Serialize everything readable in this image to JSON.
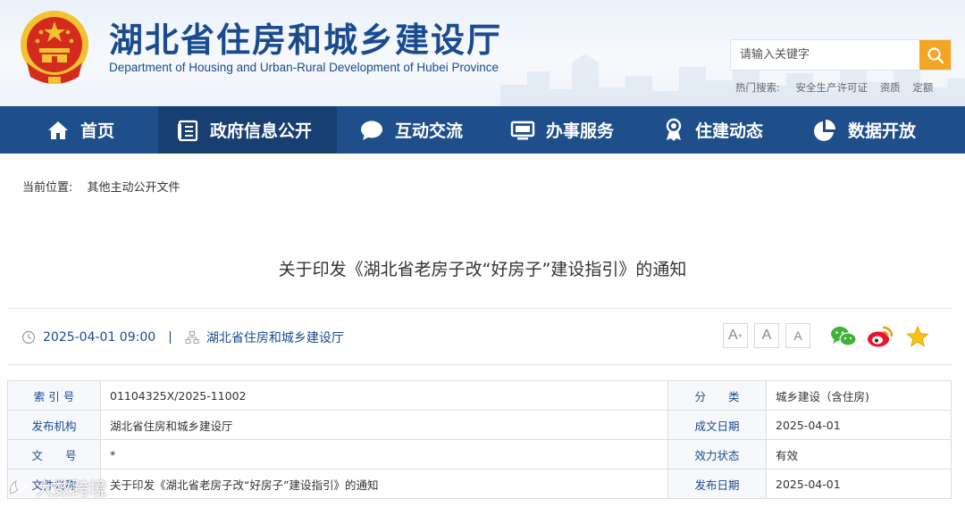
{
  "header": {
    "title": "湖北省住房和城乡建设厅",
    "subtitle": "Department of Housing and Urban-Rural Development of Hubei Province",
    "search": {
      "placeholder": "请输入关键字"
    },
    "hot_search": {
      "label": "热门搜索:",
      "items": [
        "安全生产许可证",
        "资质",
        "定额"
      ]
    },
    "colors": {
      "brand_blue": "#1a4b8f",
      "search_orange": "#f5a524",
      "emblem_red": "#d42b1e"
    }
  },
  "nav": {
    "items": [
      {
        "label": "首页",
        "icon": "home-icon"
      },
      {
        "label": "政府信息公开",
        "icon": "document-list-icon",
        "active": true
      },
      {
        "label": "互动交流",
        "icon": "chat-bubble-icon"
      },
      {
        "label": "办事服务",
        "icon": "monitor-icon"
      },
      {
        "label": "住建动态",
        "icon": "award-icon"
      },
      {
        "label": "数据开放",
        "icon": "pie-chart-icon"
      }
    ],
    "colors": {
      "background": "#1f4f8b",
      "active": "#173f72"
    }
  },
  "breadcrumb": {
    "label": "当前位置:",
    "current": "其他主动公开文件"
  },
  "article": {
    "title": "关于印发《湖北省老房子改“好房子”建设指引》的通知",
    "datetime": "2025-04-01 09:00",
    "separator": "|",
    "publisher": "湖北省住房和城乡建设厅"
  },
  "font_sizer": {
    "increase": "A",
    "increase_sup": "+",
    "normal": "A",
    "decrease": "A"
  },
  "share_icons": [
    "wechat-icon",
    "weibo-icon",
    "favorite-star-icon"
  ],
  "info_table": {
    "rows": [
      {
        "k1": "索 引 号",
        "v1": "01104325X/2025-11002",
        "k2": "分　　类",
        "v2": "城乡建设（含住房)"
      },
      {
        "k1": "发布机构",
        "v1": "湖北省住房和城乡建设厅",
        "k2": "成文日期",
        "v2": "2025-04-01"
      },
      {
        "k1": "文　　号",
        "v1": "*",
        "k2": "效力状态",
        "v2": "有效"
      },
      {
        "k1": "文件名称",
        "v1": "关于印发《湖北省老房子改“好房子”建设指引》的通知",
        "k2": "发布日期",
        "v2": "2025-04-01"
      }
    ]
  },
  "watermark": {
    "text": "大数跨境"
  }
}
